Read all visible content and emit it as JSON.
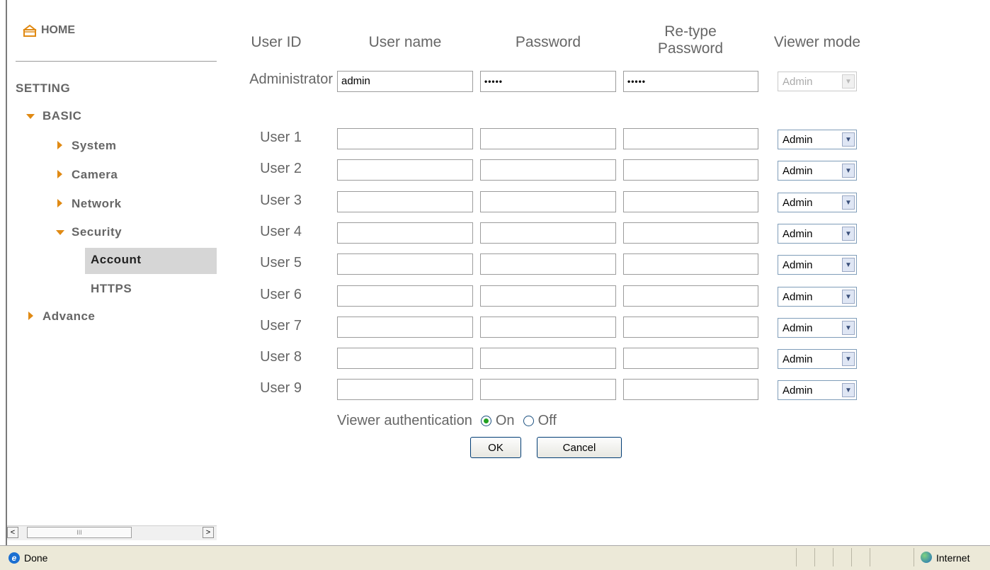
{
  "sidebar": {
    "home": "HOME",
    "setting": "SETTING",
    "basic": "BASIC",
    "basic_items": {
      "system": "System",
      "camera": "Camera",
      "network": "Network",
      "security": "Security"
    },
    "security_items": {
      "account": "Account",
      "https": "HTTPS"
    },
    "advance": "Advance",
    "selected": "Account"
  },
  "scrollbar": {
    "left_arrow": "<",
    "right_arrow": ">",
    "thumb_grip": "III"
  },
  "form": {
    "headers": {
      "user_id": "User ID",
      "user_name": "User name",
      "password": "Password",
      "retype": "Re-type Password",
      "viewer_mode": "Viewer mode"
    },
    "admin": {
      "label": "Administrator",
      "name": "admin",
      "password": "•••••",
      "retype": "•••••",
      "mode": "Admin"
    },
    "users": [
      {
        "label": "User 1",
        "mode": "Admin"
      },
      {
        "label": "User 2",
        "mode": "Admin"
      },
      {
        "label": "User 3",
        "mode": "Admin"
      },
      {
        "label": "User 4",
        "mode": "Admin"
      },
      {
        "label": "User 5",
        "mode": "Admin"
      },
      {
        "label": "User 6",
        "mode": "Admin"
      },
      {
        "label": "User 7",
        "mode": "Admin"
      },
      {
        "label": "User 8",
        "mode": "Admin"
      },
      {
        "label": "User 9",
        "mode": "Admin"
      }
    ],
    "viewer_auth": {
      "label": "Viewer authentication",
      "on": "On",
      "off": "Off",
      "selected": "On"
    },
    "ok": "OK",
    "cancel": "Cancel"
  },
  "statusbar": {
    "text": "Done",
    "zone": "Internet"
  },
  "icons": {
    "home": "home-icon",
    "expanded": "triangle-down-icon",
    "collapsed": "triangle-right-icon",
    "dropdown": "chevron-down-icon",
    "browser": "ie-icon",
    "zone": "globe-icon"
  },
  "colors": {
    "accent": "#e08a14",
    "text": "#666666",
    "highlight": "#d6d6d6"
  }
}
